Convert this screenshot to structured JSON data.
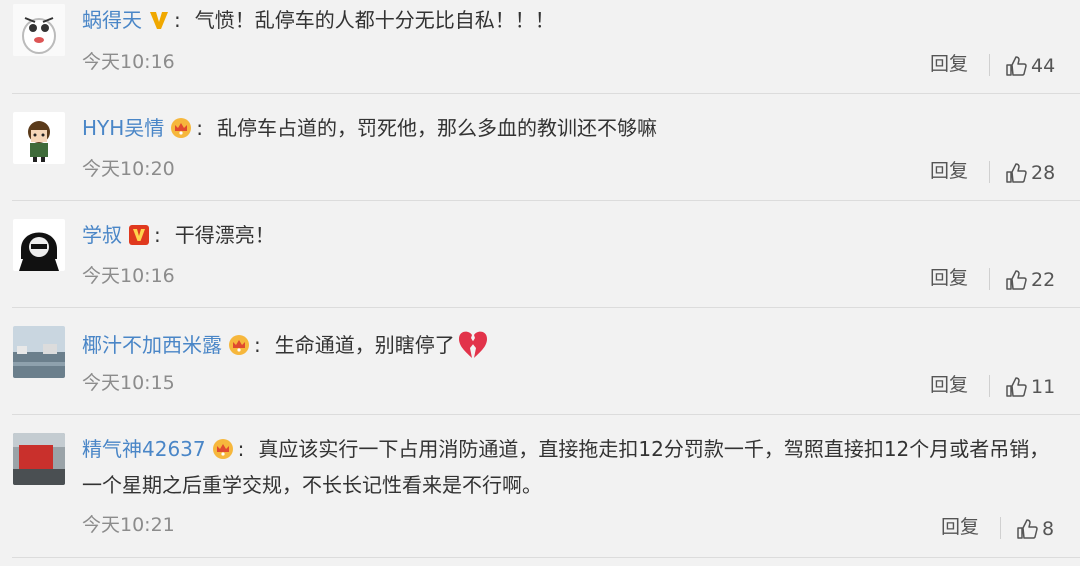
{
  "comments": [
    {
      "user": "蜗得天",
      "badge": "v-gold",
      "text": "气愤！乱停车的人都十分无比自私！！！",
      "time": "今天10:16",
      "reply": "回复",
      "likes": "44"
    },
    {
      "user": "HYH吴情",
      "badge": "crown",
      "text": "乱停车占道的，罚死他，那么多血的教训还不够嘛",
      "time": "今天10:20",
      "reply": "回复",
      "likes": "28"
    },
    {
      "user": "学叔",
      "badge": "v-red",
      "text": "干得漂亮！",
      "time": "今天10:16",
      "reply": "回复",
      "likes": "22"
    },
    {
      "user": "椰汁不加西米露",
      "badge": "crown",
      "text": "生命通道，别瞎停了",
      "emoji": "broken-heart-icon",
      "time": "今天10:15",
      "reply": "回复",
      "likes": "11"
    },
    {
      "user": "精气神42637",
      "badge": "crown",
      "text_line1": "真应该实行一下占用消防通道，直接拖走扣12分罚款一千，驾照直接扣12个月或者吊销，",
      "text_line2": "一个星期之后重学交规，不长长记性看来是不行啊。",
      "time": "今天10:21",
      "reply": "回复",
      "likes": "8"
    }
  ],
  "colors": {
    "username": "#4a86c7",
    "background": "#f2f2f2",
    "time": "#8c8c8c"
  }
}
